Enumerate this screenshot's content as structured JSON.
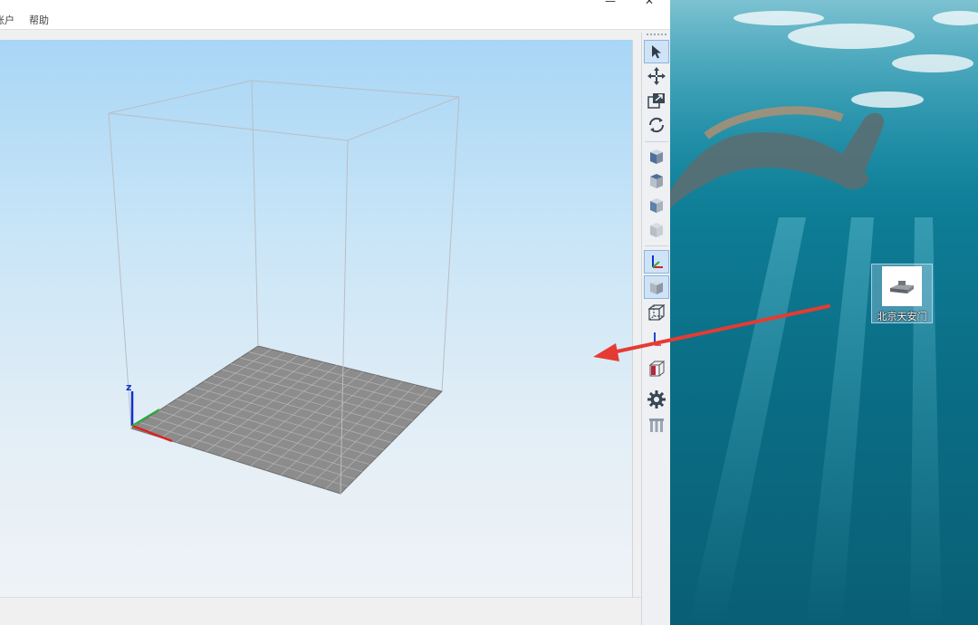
{
  "menubar": {
    "items": [
      "账户",
      "帮助"
    ]
  },
  "window_controls": {
    "minimize": "—",
    "close": "✕"
  },
  "toolbar": {
    "buttons": [
      {
        "name": "select-arrow-icon",
        "active": true
      },
      {
        "name": "move-icon",
        "active": false
      },
      {
        "name": "scale-icon",
        "active": false
      },
      {
        "name": "rotate-icon",
        "active": false
      },
      {
        "name": "view-cube-front-icon",
        "active": false
      },
      {
        "name": "view-cube-top-icon",
        "active": false
      },
      {
        "name": "view-cube-side-icon",
        "active": false
      },
      {
        "name": "view-cube-back-icon",
        "active": false
      },
      {
        "name": "axis-toggle-icon",
        "active": true
      },
      {
        "name": "solid-view-icon",
        "active": true
      },
      {
        "name": "wireframe-view-icon",
        "active": false
      },
      {
        "name": "axis-small-icon",
        "active": false
      },
      {
        "name": "section-view-icon",
        "active": false
      },
      {
        "name": "settings-gear-icon",
        "active": false
      },
      {
        "name": "support-pillars-icon",
        "active": false
      }
    ]
  },
  "viewport": {
    "axes": {
      "z_label": "z"
    }
  },
  "desktop": {
    "icon_label": "北京天安门"
  },
  "colors": {
    "arrow": "#e53b33",
    "build_plate": "#8c8c8c",
    "axis_x": "#e02020",
    "axis_y": "#20b030",
    "axis_z": "#1030d0"
  }
}
